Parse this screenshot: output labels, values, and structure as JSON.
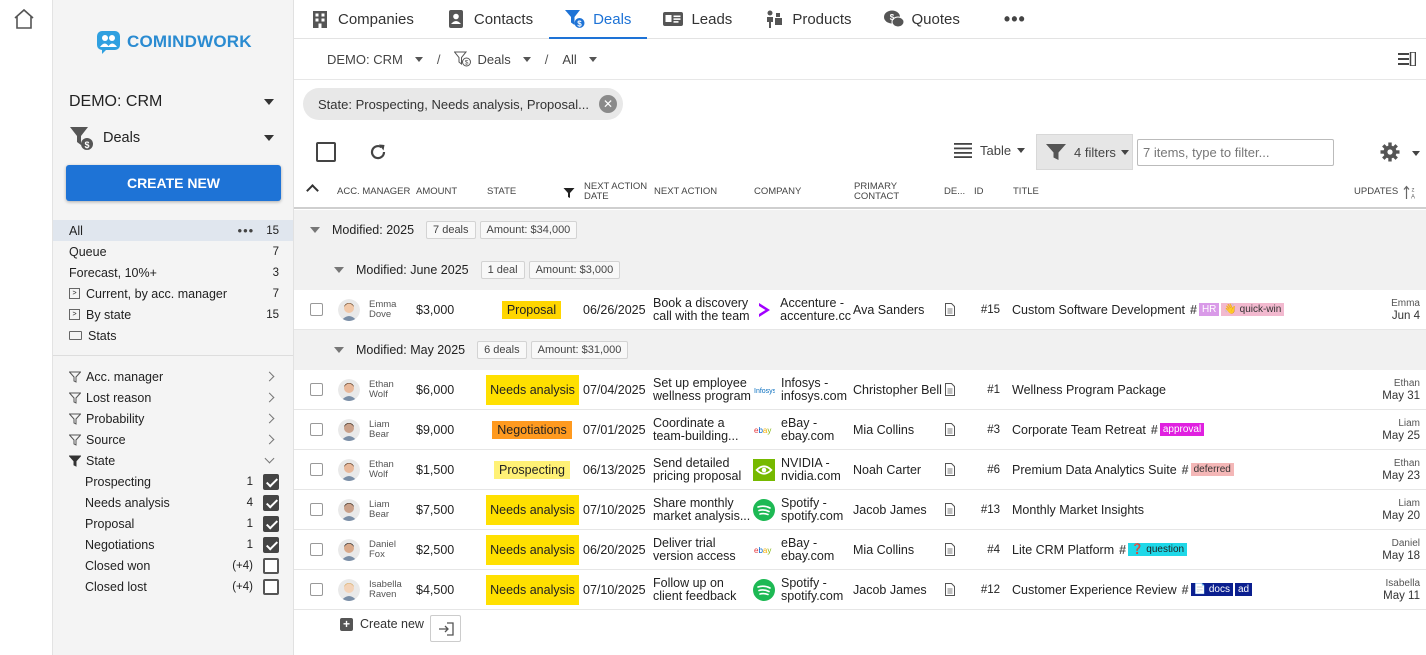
{
  "app": {
    "logo_text": "COMINDWORK",
    "workspace": "DEMO: CRM",
    "module": "Deals",
    "create_new": "CREATE NEW"
  },
  "views": [
    {
      "label": "All",
      "count": "15",
      "active": true
    },
    {
      "label": "Queue",
      "count": "7"
    },
    {
      "label": "Forecast, 10%+",
      "count": "3"
    },
    {
      "label": "Current, by acc. manager",
      "count": "7",
      "icon": "grouping-icon"
    },
    {
      "label": "By state",
      "count": "15",
      "icon": "grouping-icon"
    },
    {
      "label": "Stats",
      "count": "",
      "icon": "folder-icon"
    }
  ],
  "filters": [
    {
      "label": "Acc. manager"
    },
    {
      "label": "Lost reason"
    },
    {
      "label": "Probability"
    },
    {
      "label": "Source"
    },
    {
      "label": "State"
    }
  ],
  "state_options": [
    {
      "label": "Prospecting",
      "count": "1",
      "checked": true
    },
    {
      "label": "Needs analysis",
      "count": "4",
      "checked": true
    },
    {
      "label": "Proposal",
      "count": "1",
      "checked": true
    },
    {
      "label": "Negotiations",
      "count": "1",
      "checked": true
    },
    {
      "label": "Closed won",
      "count": "(+4)",
      "checked": false
    },
    {
      "label": "Closed lost",
      "count": "(+4)",
      "checked": false
    }
  ],
  "tabs": [
    {
      "label": "Companies",
      "icon": "building-icon"
    },
    {
      "label": "Contacts",
      "icon": "contact-book-icon"
    },
    {
      "label": "Deals",
      "icon": "deals-funnel-icon",
      "active": true
    },
    {
      "label": "Leads",
      "icon": "id-card-icon"
    },
    {
      "label": "Products",
      "icon": "products-icon"
    },
    {
      "label": "Quotes",
      "icon": "quotes-icon"
    }
  ],
  "more_tabs": "•••",
  "breadcrumb": {
    "workspace": "DEMO: CRM",
    "module": "Deals",
    "view": "All",
    "sep": "/"
  },
  "filter_chip": "State: Prospecting, Needs analysis, Proposal...",
  "toolbar": {
    "layout": "Table",
    "filters_label": "4 filters",
    "filter_placeholder": "7 items, type to filter..."
  },
  "columns": {
    "acc_manager": "ACC. MANAGER",
    "amount": "AMOUNT",
    "state": "STATE",
    "next_action_date": "NEXT ACTION DATE",
    "next_action": "NEXT ACTION",
    "company": "COMPANY",
    "primary_contact": "PRIMARY CONTACT",
    "description": "DE...",
    "id": "ID",
    "title": "TITLE",
    "updates": "UPDATES"
  },
  "groups": {
    "year": {
      "label": "Modified:",
      "value": "2025",
      "deals": "7 deals",
      "amount": "Amount: $34,000"
    },
    "june": {
      "label": "Modified:",
      "value": "June 2025",
      "deals": "1 deal",
      "amount": "Amount: $3,000"
    },
    "may": {
      "label": "Modified:",
      "value": "May 2025",
      "deals": "6 deals",
      "amount": "Amount: $31,000"
    }
  },
  "rows": [
    {
      "mgr1": "Emma",
      "mgr2": "Dove",
      "amount": "$3,000",
      "state": "Proposal",
      "state_color": "#ffd600",
      "date": "06/26/2025",
      "action1": "Book a discovery",
      "action2": "call with the team",
      "company1": "Accenture -",
      "company2": "accenture.cc",
      "company_logo": "accenture-logo",
      "contact": "Ava Sanders",
      "id": "#15",
      "title": "Custom Software Development",
      "tags": [
        {
          "text": "HR",
          "bg": "#d99ae8",
          "fg": "#fff"
        },
        {
          "text": "👋 quick-win",
          "bg": "#f2b9cf",
          "fg": "#333"
        }
      ],
      "upd_name": "Emma",
      "upd_date": "Jun 4"
    },
    {
      "mgr1": "Ethan",
      "mgr2": "Wolf",
      "amount": "$6,000",
      "state": "Needs analysis",
      "state_color": "#ffe000",
      "date": "07/04/2025",
      "action1": "Set up employee",
      "action2": "wellness program",
      "company1": "Infosys -",
      "company2": "infosys.com",
      "company_logo": "infosys-logo",
      "contact": "Christopher Bell",
      "id": "#1",
      "title": "Wellness Program Package",
      "tags": [],
      "upd_name": "Ethan",
      "upd_date": "May 31"
    },
    {
      "mgr1": "Liam",
      "mgr2": "Bear",
      "amount": "$9,000",
      "state": "Negotiations",
      "state_color": "#ff9a1f",
      "date": "07/01/2025",
      "action1": "Coordinate a",
      "action2": "team-building...",
      "company1": "eBay -",
      "company2": "ebay.com",
      "company_logo": "ebay-logo",
      "contact": "Mia Collins",
      "id": "#3",
      "title": "Corporate Team Retreat",
      "tags": [
        {
          "text": "approval",
          "bg": "#e020e0",
          "fg": "#fff"
        }
      ],
      "upd_name": "Liam",
      "upd_date": "May 25"
    },
    {
      "mgr1": "Ethan",
      "mgr2": "Wolf",
      "amount": "$1,500",
      "state": "Prospecting",
      "state_color": "#fff176",
      "date": "06/13/2025",
      "action1": "Send detailed",
      "action2": "pricing proposal",
      "company1": "NVIDIA -",
      "company2": "nvidia.com",
      "company_logo": "nvidia-logo",
      "contact": "Noah Carter",
      "id": "#6",
      "title": "Premium Data Analytics Suite",
      "tags": [
        {
          "text": "deferred",
          "bg": "#f4b7b7",
          "fg": "#333"
        }
      ],
      "upd_name": "Ethan",
      "upd_date": "May 23"
    },
    {
      "mgr1": "Liam",
      "mgr2": "Bear",
      "amount": "$7,500",
      "state": "Needs analysis",
      "state_color": "#ffe000",
      "date": "07/10/2025",
      "action1": "Share monthly",
      "action2": "market analysis...",
      "company1": "Spotify -",
      "company2": "spotify.com",
      "company_logo": "spotify-logo",
      "contact": "Jacob James",
      "id": "#13",
      "title": "Monthly Market Insights",
      "tags": [],
      "upd_name": "Liam",
      "upd_date": "May 20"
    },
    {
      "mgr1": "Daniel",
      "mgr2": "Fox",
      "amount": "$2,500",
      "state": "Needs analysis",
      "state_color": "#ffe000",
      "date": "06/20/2025",
      "action1": "Deliver trial",
      "action2": "version access",
      "company1": "eBay -",
      "company2": "ebay.com",
      "company_logo": "ebay-logo",
      "contact": "Mia Collins",
      "id": "#4",
      "title": "Lite CRM Platform",
      "tags": [
        {
          "text": "❓ question",
          "bg": "#1fd8e8",
          "fg": "#222"
        }
      ],
      "upd_name": "Daniel",
      "upd_date": "May 18"
    },
    {
      "mgr1": "Isabella",
      "mgr2": "Raven",
      "amount": "$4,500",
      "state": "Needs analysis",
      "state_color": "#ffe000",
      "date": "07/10/2025",
      "action1": "Follow up on",
      "action2": "client feedback",
      "company1": "Spotify -",
      "company2": "spotify.com",
      "company_logo": "spotify-logo",
      "contact": "Jacob James",
      "id": "#12",
      "title": "Customer Experience Review",
      "tags": [
        {
          "text": "📄 docs",
          "bg": "#0b1f8f",
          "fg": "#fff"
        },
        {
          "text": "ad",
          "bg": "#0b1f8f",
          "fg": "#fff"
        }
      ],
      "upd_name": "Isabella",
      "upd_date": "May 11"
    }
  ],
  "footer": {
    "create_new": "Create new"
  }
}
